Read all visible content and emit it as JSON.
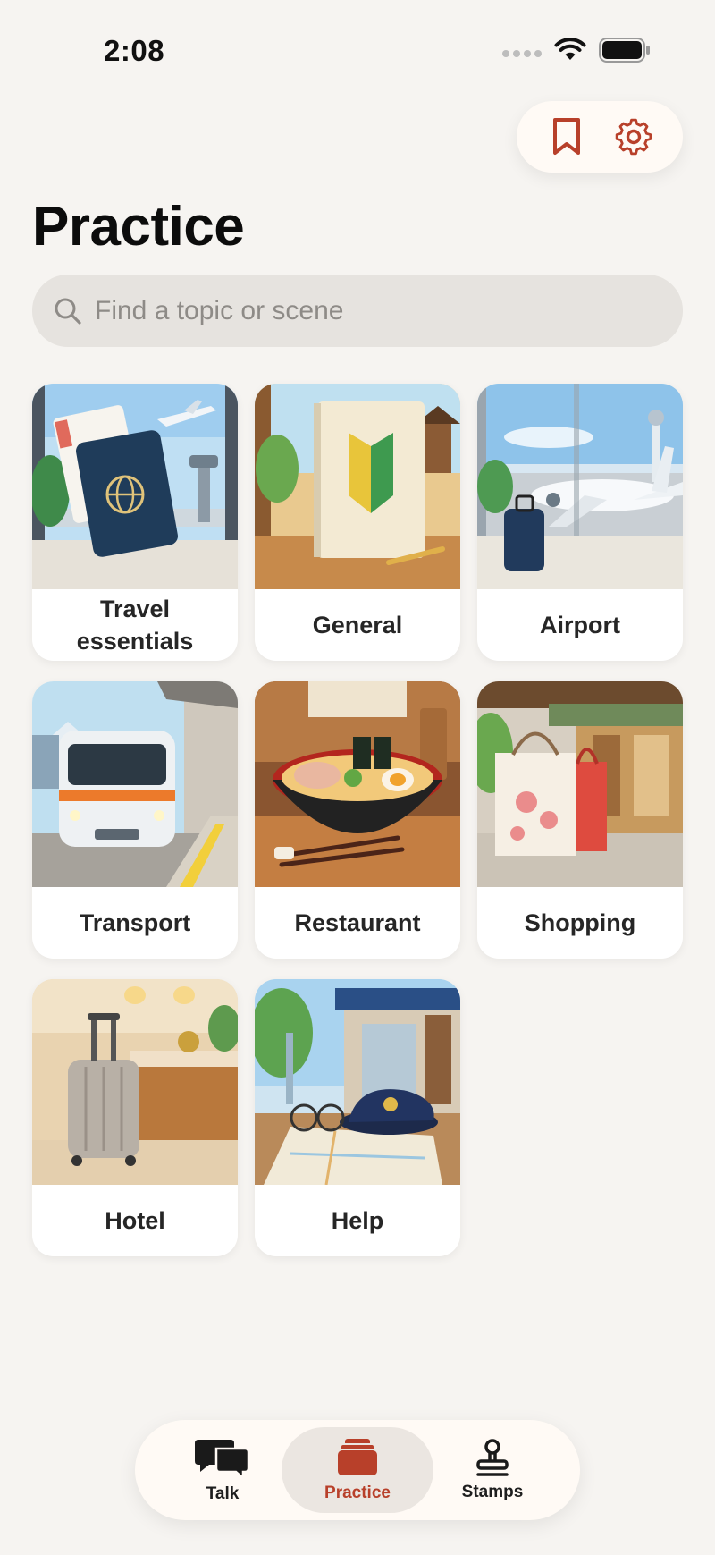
{
  "status_bar": {
    "time": "2:08"
  },
  "header": {
    "title": "Practice"
  },
  "search": {
    "placeholder": "Find a topic or scene"
  },
  "topics": [
    {
      "label": "Travel essentials",
      "icon": "passport-illustration"
    },
    {
      "label": "General",
      "icon": "beginner-mark-book-illustration"
    },
    {
      "label": "Airport",
      "icon": "airplane-illustration"
    },
    {
      "label": "Transport",
      "icon": "train-illustration"
    },
    {
      "label": "Restaurant",
      "icon": "ramen-illustration"
    },
    {
      "label": "Shopping",
      "icon": "shopping-bags-illustration"
    },
    {
      "label": "Hotel",
      "icon": "suitcase-illustration"
    },
    {
      "label": "Help",
      "icon": "police-cap-map-illustration"
    }
  ],
  "tabbar": {
    "items": [
      {
        "label": "Talk",
        "icon": "chat-bubbles-icon"
      },
      {
        "label": "Practice",
        "icon": "cards-icon",
        "active": true
      },
      {
        "label": "Stamps",
        "icon": "stamp-icon"
      }
    ]
  },
  "colors": {
    "accent": "#b8402a",
    "background": "#f6f4f1",
    "card": "#ffffff"
  }
}
